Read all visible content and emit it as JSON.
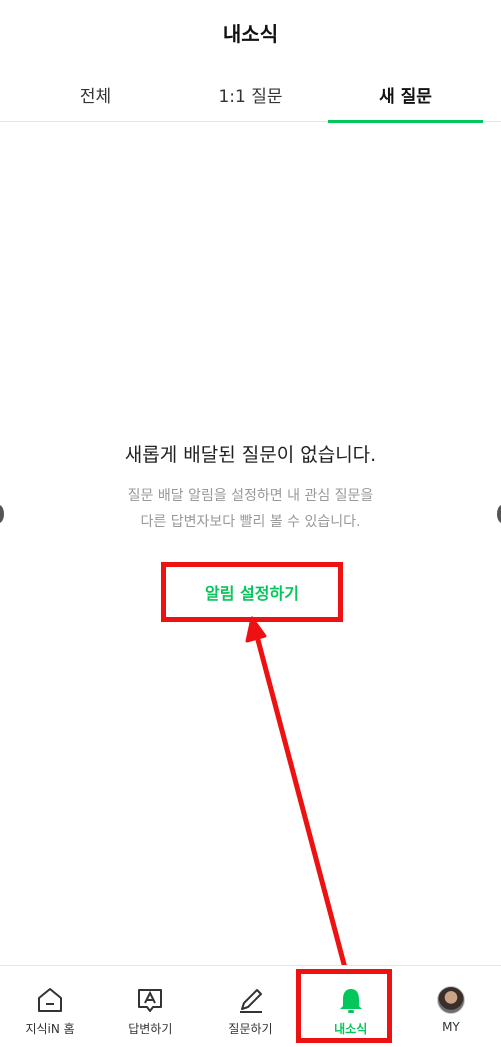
{
  "header": {
    "title": "내소식",
    "tabs": [
      {
        "label": "전체"
      },
      {
        "label": "1:1 질문"
      },
      {
        "label": "새 질문"
      }
    ]
  },
  "empty_state": {
    "title": "새롭게 배달된 질문이 없습니다.",
    "desc_line1": "질문 배달 알림을 설정하면 내 관심 질문을",
    "desc_line2": "다른 답변자보다 빨리 볼 수 있습니다.",
    "button_label": "알림 설정하기"
  },
  "bottom_nav": {
    "items": [
      {
        "label": "지식iN 홈",
        "icon": "home-icon"
      },
      {
        "label": "답변하기",
        "icon": "answer-icon"
      },
      {
        "label": "질문하기",
        "icon": "pencil-icon"
      },
      {
        "label": "내소식",
        "icon": "bell-icon"
      },
      {
        "label": "MY",
        "icon": "avatar-icon"
      }
    ]
  },
  "colors": {
    "accent": "#03c75a",
    "annotation": "#ee1111"
  }
}
